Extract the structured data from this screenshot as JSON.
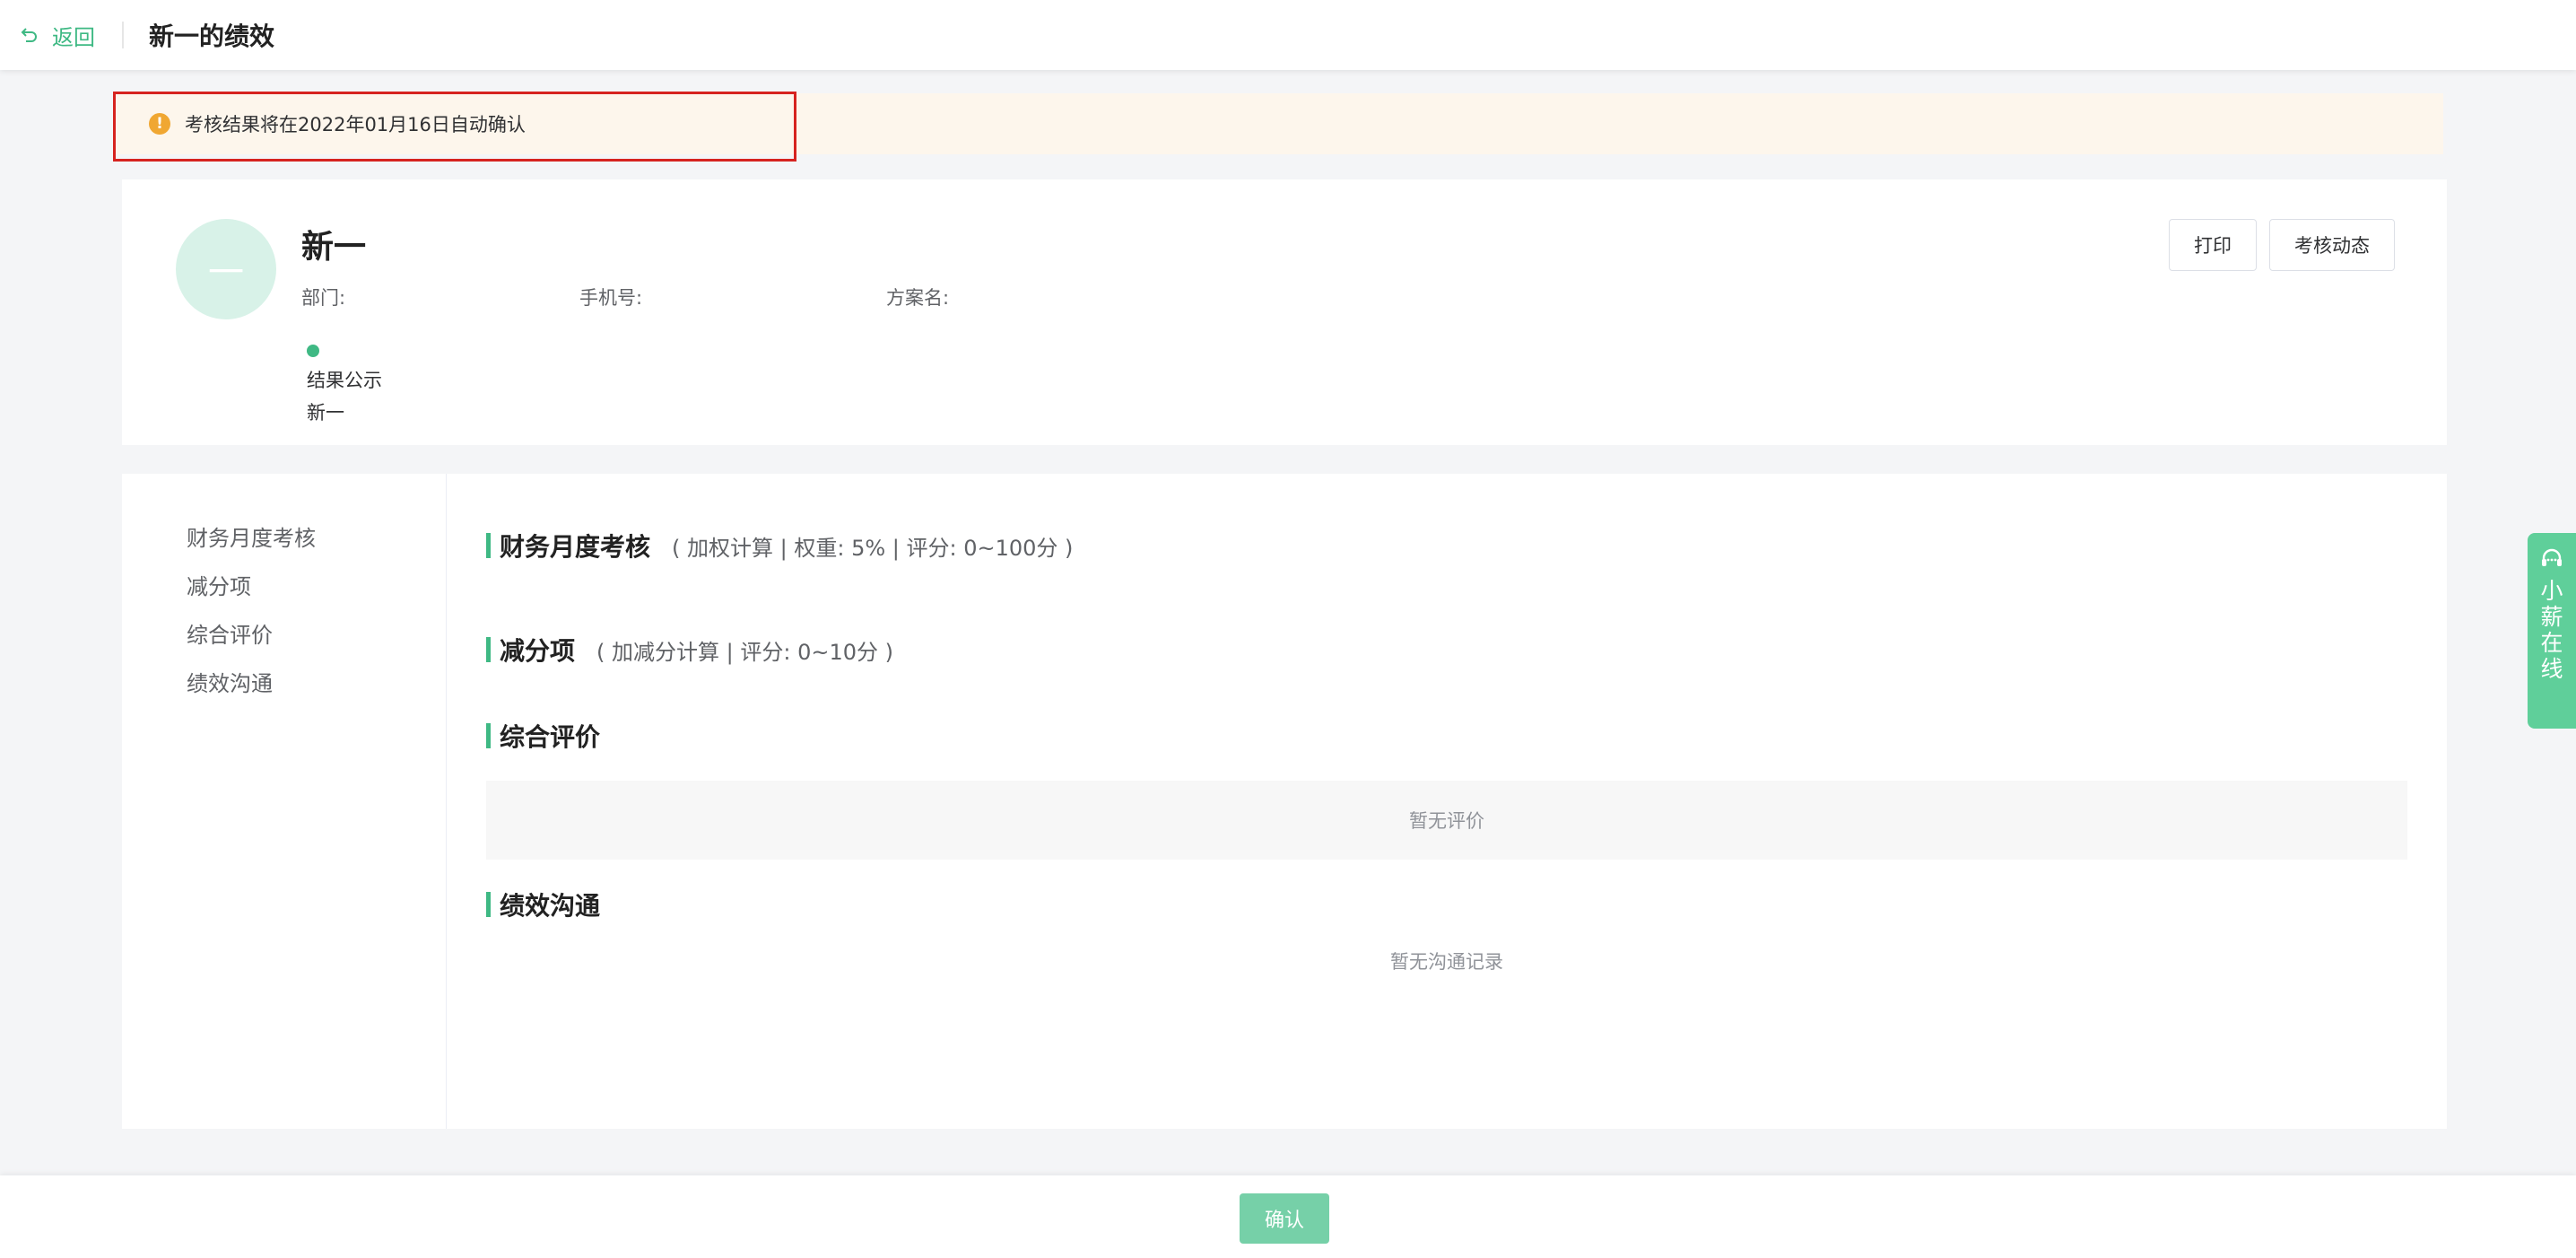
{
  "header": {
    "back_label": "返回",
    "title": "新一的绩效",
    "back_icon": "undo-arrow-icon"
  },
  "notice": {
    "icon": "warning-icon",
    "icon_glyph": "!",
    "text": "考核结果将在2022年01月16日自动确认"
  },
  "profile": {
    "avatar_glyph": "一",
    "name": "新一",
    "dept_label": "部门:",
    "phone_label": "手机号:",
    "plan_label": "方案名:",
    "stage_label": "结果公示",
    "stage_user": "新一",
    "print_label": "打印",
    "dynamic_label": "考核动态"
  },
  "sidebar": {
    "items": [
      {
        "label": "财务月度考核"
      },
      {
        "label": "减分项"
      },
      {
        "label": "综合评价"
      },
      {
        "label": "绩效沟通"
      }
    ]
  },
  "sections": {
    "finance": {
      "title": "财务月度考核",
      "meta": "( 加权计算 | 权重: 5% | 评分: 0~100分 )"
    },
    "deduction": {
      "title": "减分项",
      "meta": "( 加减分计算 | 评分: 0~10分 )"
    },
    "overall": {
      "title": "综合评价",
      "empty": "暂无评价"
    },
    "communication": {
      "title": "绩效沟通",
      "empty": "暂无沟通记录"
    }
  },
  "float_service": {
    "icon": "headset-icon",
    "text": "小薪在线"
  },
  "footer": {
    "confirm_label": "确认"
  },
  "colors": {
    "accent": "#3fb984",
    "notice_bg": "#fdf6ec",
    "warning": "#f0a732"
  }
}
